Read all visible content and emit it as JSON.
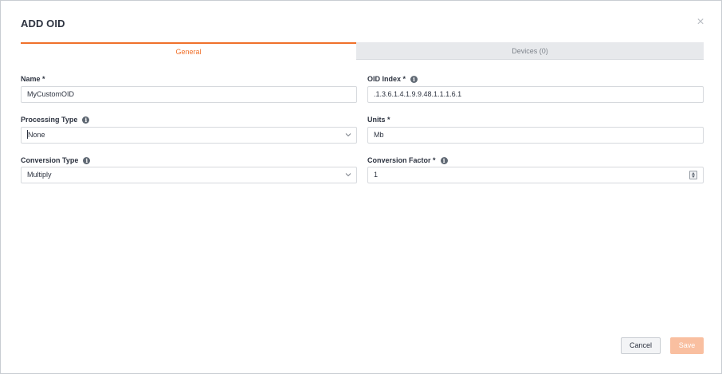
{
  "dialog": {
    "title": "ADD OID",
    "close_glyph": "×"
  },
  "tabs": [
    {
      "label": "General",
      "active": true
    },
    {
      "label": "Devices (0)",
      "active": false
    }
  ],
  "form": {
    "name": {
      "label": "Name *",
      "value": "MyCustomOID"
    },
    "oid_index": {
      "label": "OID Index *",
      "value": ".1.3.6.1.4.1.9.9.48.1.1.1.6.1",
      "info_icon": "info-icon"
    },
    "processing_type": {
      "label": "Processing Type",
      "value": "None",
      "info_icon": "info-icon"
    },
    "units": {
      "label": "Units *",
      "value": "Mb"
    },
    "conversion_type": {
      "label": "Conversion Type",
      "value": "Multiply",
      "info_icon": "info-icon"
    },
    "conversion_factor": {
      "label": "Conversion Factor *",
      "value": "1",
      "info_icon": "info-icon"
    }
  },
  "buttons": {
    "cancel": "Cancel",
    "save": "Save"
  },
  "colors": {
    "accent": "#f0712b",
    "save_disabled": "#f9bfa0",
    "text": "#2d3340"
  }
}
